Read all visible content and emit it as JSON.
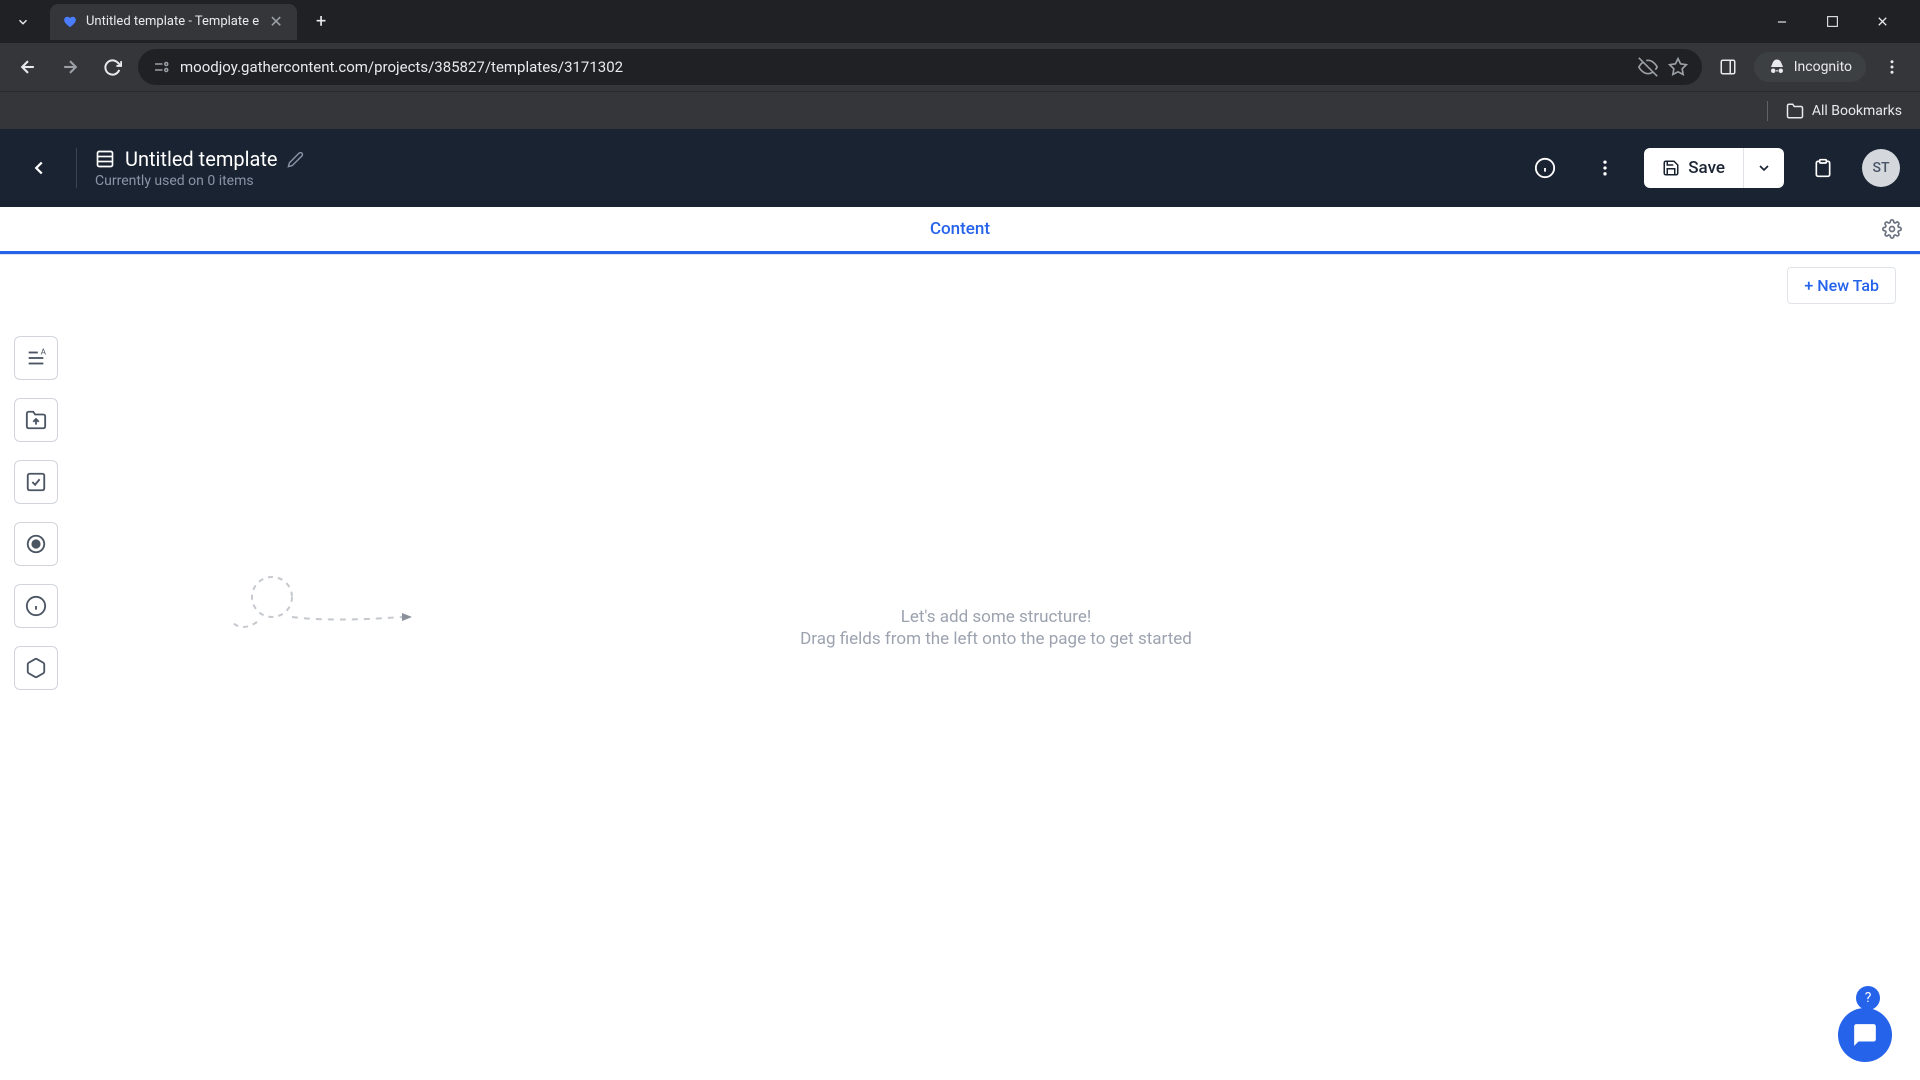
{
  "browser": {
    "tab_title": "Untitled template - Template e",
    "url": "moodjoy.gathercontent.com/projects/385827/templates/3171302",
    "incognito_label": "Incognito",
    "all_bookmarks": "All Bookmarks"
  },
  "header": {
    "template_title": "Untitled template",
    "template_subtitle": "Currently used on 0 items",
    "save_label": "Save",
    "avatar_initials": "ST"
  },
  "tabs": {
    "active": "Content",
    "new_tab_label": "+ New Tab"
  },
  "empty_state": {
    "title": "Let's add some structure!",
    "subtitle": "Drag fields from the left onto the page to get started"
  },
  "help_label": "?"
}
